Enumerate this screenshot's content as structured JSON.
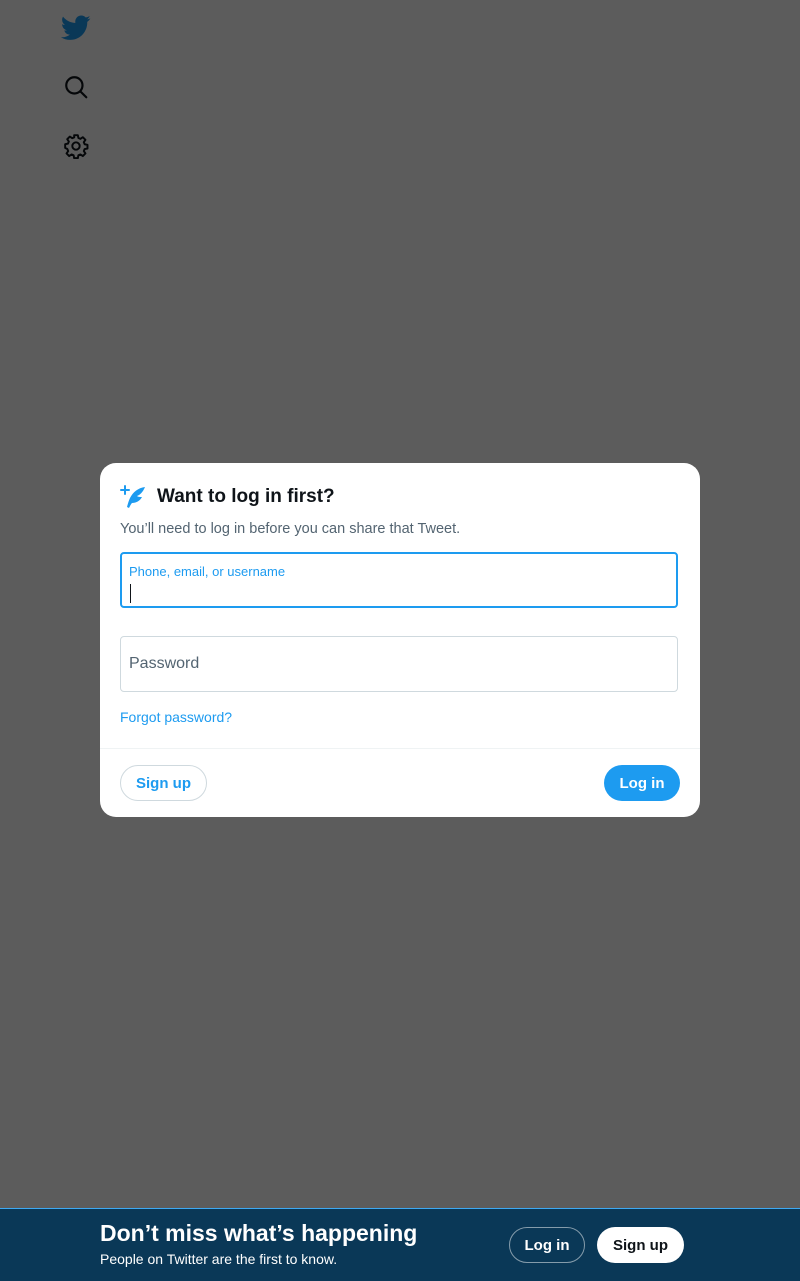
{
  "sidebar": {
    "icons": [
      "twitter-logo-icon",
      "search-icon",
      "gear-icon"
    ]
  },
  "modal": {
    "title": "Want to log in first?",
    "description": "You’ll need to log in before you can share that Tweet.",
    "username_field": {
      "label": "Phone, email, or username",
      "value": ""
    },
    "password_field": {
      "label": "Password",
      "value": ""
    },
    "forgot_password": "Forgot password?",
    "signup_label": "Sign up",
    "login_label": "Log in"
  },
  "bottom_bar": {
    "title": "Don’t miss what’s happening",
    "subtitle": "People on Twitter are the first to know.",
    "login_label": "Log in",
    "signup_label": "Sign up"
  },
  "colors": {
    "brand": "#1d9bf0",
    "text": "#0f1419",
    "secondary_text": "#536471"
  }
}
